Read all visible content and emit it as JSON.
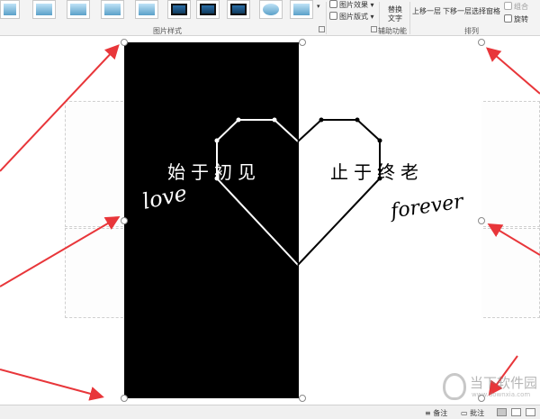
{
  "ribbon": {
    "picture_styles_label": "图片样式",
    "picture_effects": "图片效果",
    "picture_layout": "图片版式",
    "alt_text_line1": "替换",
    "alt_text_line2": "文字",
    "accessibility_label": "辅助功能",
    "bring_forward": "上移一层",
    "send_backward": "下移一层",
    "selection_pane": "选择窗格",
    "group": "组合",
    "rotate": "旋转",
    "arrange_label": "排列"
  },
  "picture": {
    "left_text": "始于初见",
    "right_text": "止于终老",
    "left_script": "love",
    "right_script": "forever"
  },
  "statusbar": {
    "notes": "备注",
    "comments": "批注"
  },
  "watermark": {
    "name": "当下软件园",
    "url": "www.downxia.com"
  },
  "colors": {
    "arrow": "#e8363a",
    "picture_left": "#000000",
    "picture_right": "#ffffff"
  }
}
